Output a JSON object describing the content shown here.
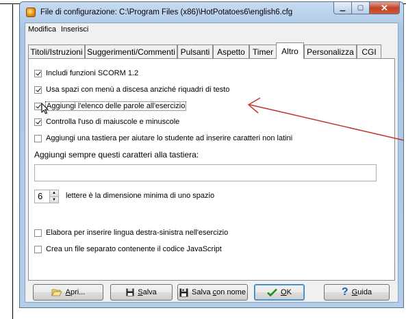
{
  "window": {
    "title": "File di configurazione: C:\\Program Files (x86)\\HotPotatoes6\\english6.cfg"
  },
  "menu": [
    "Modifica",
    "Inserisci"
  ],
  "tabs": [
    {
      "label": "Titoli/Istruzioni",
      "active": false
    },
    {
      "label": "Suggerimenti/Commenti",
      "active": false
    },
    {
      "label": "Pulsanti",
      "active": false
    },
    {
      "label": "Aspetto",
      "active": false
    },
    {
      "label": "Timer",
      "active": false
    },
    {
      "label": "Altro",
      "active": true
    },
    {
      "label": "Personalizza",
      "active": false
    },
    {
      "label": "CGI",
      "active": false
    }
  ],
  "options": {
    "scorm": {
      "label": "Includi funzioni SCORM 1.2",
      "checked": true
    },
    "dropdowns": {
      "label": "Usa spazi con menù a discesa anziché riquadri di testo",
      "checked": true
    },
    "word_list": {
      "label": "Aggiungi l'elenco delle parole all'esercizio",
      "checked": true
    },
    "case": {
      "label": "Controlla l'uso di maiuscole e minuscole",
      "checked": true
    },
    "keyboard": {
      "label": "Aggiungi una tastiera per aiutare lo studente ad inserire caratteri non latini",
      "checked": false
    },
    "rtl": {
      "label": "Elabora per inserire lingua destra-sinistra nell'esercizio",
      "checked": false
    },
    "separate_js": {
      "label": "Crea un file separato contenente il codice JavaScript",
      "checked": false
    }
  },
  "keyboard_chars": {
    "label": "Aggiungi sempre questi caratteri alla tastiera:",
    "value": ""
  },
  "min_gap": {
    "value": "6",
    "label": "lettere è la dimensione minima di uno spazio"
  },
  "buttons": {
    "open": {
      "prefix": "",
      "accel": "A",
      "rest": "pri..."
    },
    "save": {
      "prefix": "",
      "accel": "S",
      "rest": "alva"
    },
    "save_as": {
      "prefix": "Salva ",
      "accel": "c",
      "rest": "on nome"
    },
    "ok": {
      "prefix": "",
      "accel": "O",
      "rest": "K"
    },
    "help": {
      "prefix": "",
      "accel": "G",
      "rest": "uida"
    }
  },
  "colors": {
    "annotation_arrow": "#c0392b",
    "title_bar": "#b3cdea",
    "close_button": "#c24428"
  }
}
